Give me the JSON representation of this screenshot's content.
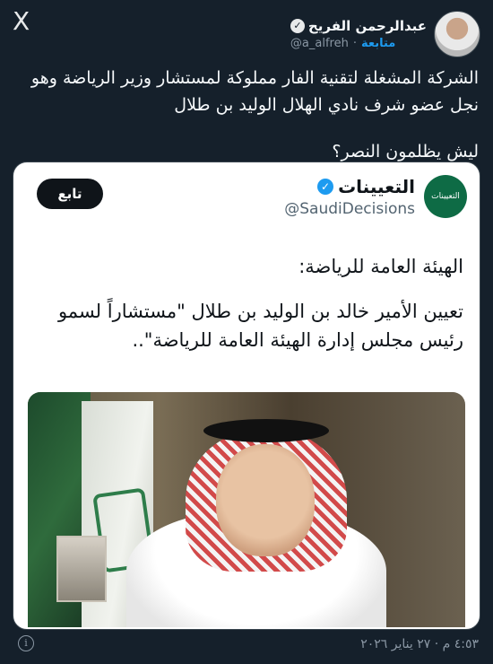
{
  "header": {
    "author_name": "عبدالرحمن الفريح",
    "author_handle": "@a_alfreh",
    "separator": "·",
    "follow_label": "متابعة",
    "x_logo": "X"
  },
  "tweet": {
    "line1": "الشركة المشغلة لتقنية الفار مملوكة لمستشار وزير الرياضة وهو نجل عضو شرف نادي الهلال الوليد بن طلال",
    "line2": "ليش يظلمون النصر؟"
  },
  "quoted": {
    "name": "التعيينات",
    "handle": "@SaudiDecisions",
    "follow_label": "تابع",
    "avatar_text": "التعيينات",
    "text_heading": "الهيئة العامة للرياضة:",
    "text_body": "تعيين الأمير خالد بن الوليد بن طلال \"مستشاراً لسمو رئيس مجلس إدارة الهيئة العامة للرياضة\"..",
    "image_description": "person-photo"
  },
  "footer": {
    "timestamp": "٤:٥٣ م · ٢٧ يناير ٢٠٢٦",
    "info_icon": "i"
  },
  "icons": {
    "verified": "✓"
  }
}
